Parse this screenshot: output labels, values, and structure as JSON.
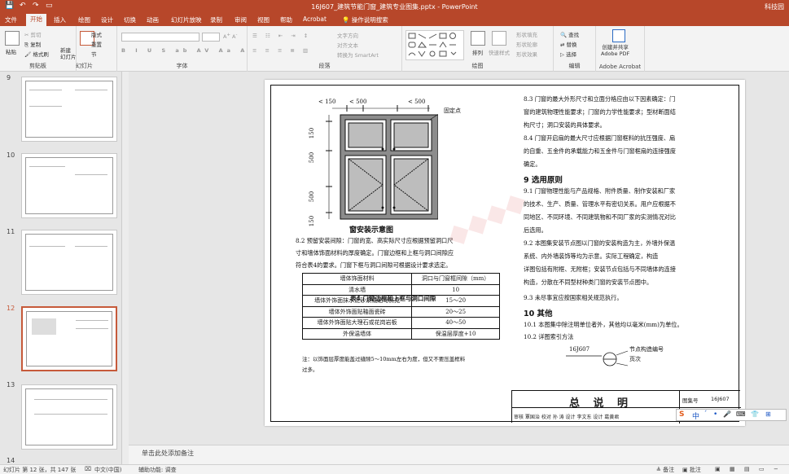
{
  "titlebar": {
    "title": "16J607_建筑节能门窗_建筑专业图集.pptx  -  PowerPoint",
    "user": "科技园",
    "autosave_icon": "save-icon"
  },
  "tabs": [
    "文件",
    "开始",
    "插入",
    "绘图",
    "设计",
    "切换",
    "动画",
    "幻灯片放映",
    "录制",
    "审阅",
    "视图",
    "帮助",
    "Acrobat",
    "操作说明搜索"
  ],
  "ribbon": {
    "clipboard": {
      "label": "剪贴板",
      "paste": "粘贴",
      "cut": "剪切",
      "copy": "复制",
      "format_painter": "格式刷"
    },
    "slides": {
      "label": "幻灯片",
      "new_slide": "新建\n幻灯片",
      "layout": "版式",
      "reset": "重置",
      "section": "节"
    },
    "font": {
      "label": "字体"
    },
    "paragraph": {
      "label": "段落",
      "text_direction": "文字方向",
      "align_text": "对齐文本",
      "smartart": "转换为 SmartArt"
    },
    "drawing": {
      "label": "绘图",
      "arrange": "排列",
      "quick_styles": "快速样式",
      "fill": "形状填充",
      "outline": "形状轮廓",
      "effects": "形状效果"
    },
    "editing": {
      "label": "编辑",
      "find": "查找",
      "replace": "替换",
      "select": "选择"
    },
    "acrobat": {
      "label": "Adobe Acrobat",
      "create": "创建并共享\nAdobe PDF"
    }
  },
  "thumbnails": [
    {
      "num": "9"
    },
    {
      "num": "10"
    },
    {
      "num": "11"
    },
    {
      "num": "12"
    },
    {
      "num": "13"
    },
    {
      "num": "14"
    }
  ],
  "slide": {
    "diagram": {
      "dim_top_left": "150",
      "dim_top_mid": "500",
      "dim_top_right": "500",
      "dim_side_1": "150",
      "dim_side_2": "500",
      "dim_side_3": "500",
      "dim_side_4": "150",
      "fixing_point": "固定点",
      "caption": "窗安装示意图"
    },
    "left_para": [
      "8.2  预留安装间隙：门窗的宽、高实际尺寸应根据预留洞口尺",
      "寸和墙体饰面材料的厚度确定。门窗边框和上框与洞口间隙应",
      "符合表4的要求。门窗下框与洞口间隙可根据设计要求选定。"
    ],
    "table_title": "表4    门窗边框和上框与洞口间隙",
    "table": {
      "headers": [
        "墙体饰面材料",
        "洞口与门窗框间隙（mm）"
      ],
      "rows": [
        [
          "清水墙",
          "10"
        ],
        [
          "墙体外饰面抹水泥砂浆或贴马赛克",
          "15～20"
        ],
        [
          "墙体外饰面贴釉面瓷砖",
          "20～25"
        ],
        [
          "墙体外饰面贴大理石或花岗岩板",
          "40～50"
        ],
        [
          "外保温墙体",
          "保温层厚度+10"
        ]
      ]
    },
    "table_note": [
      "注：以饰面层厚度能盖过缝隙5～10mm左右为度，但又不要压盖框料",
      "      过多。"
    ],
    "right_para1": [
      "8.3  门窗的最大外形尺寸和立面分格应由以下因素确定：门",
      "窗的建筑物理性能要求；门窗的力学性能要求；型材断面结",
      "构尺寸；洞口安装的具体要求。",
      "8.4  门窗开启扇的最大尺寸应根据门窗框料的抗压强度、扇",
      "的自重、五金件的承载能力和五金件与门窗框扇的连接强度",
      "确定。"
    ],
    "heading9": "9  选用原则",
    "right_para2": [
      "9.1  门窗物理性能与产品规格、附件质量、制作安装和厂家",
      "的技术、生产、质量、管理水平有密切关系。用户应根据不",
      "同地区、不同环境、不同建筑物和不同厂家的实测情况对比",
      "后选用。",
      "9.2  本图集安装节点图以门窗的安装构造为主，外墙外保温",
      "系统、内外墙装饰等均为示意。实际工程确定，构造",
      "详图包括有附框、无附框；安装节点包括与不同墙体的连接",
      "构造，分散在不同型材种类门窗的安装节点图中。",
      "9.3  未尽事宜应按国家相关规范执行。"
    ],
    "heading10": "10  其他",
    "right_para3": [
      "10.1  本图集中除注明单位者外，其他均以毫米(mm)为单位。",
      "10.2  详图索引方法"
    ],
    "index": {
      "code": "16J607",
      "node_label": "节点构造编号",
      "page_label": "页次"
    },
    "titleblock": {
      "title": "总    说    明",
      "atlas_label": "图集号",
      "atlas_no": "16J607",
      "review_row": "审核 覃国治  校对 孙 涛  设计 李文东  设计 葛黄君",
      "page_label": "页"
    }
  },
  "notes_placeholder": "单击此处添加备注",
  "status": {
    "slide_info": "幻灯片 第 12 张，共 147 张",
    "language": "中文(中国)",
    "accessibility": "辅助功能: 调查",
    "notes": "备注",
    "comments": "批注"
  },
  "ime": {
    "items": [
      "S",
      "中",
      "ˊ",
      "•",
      "🎤",
      "⌨",
      "👕",
      "⊞"
    ]
  }
}
